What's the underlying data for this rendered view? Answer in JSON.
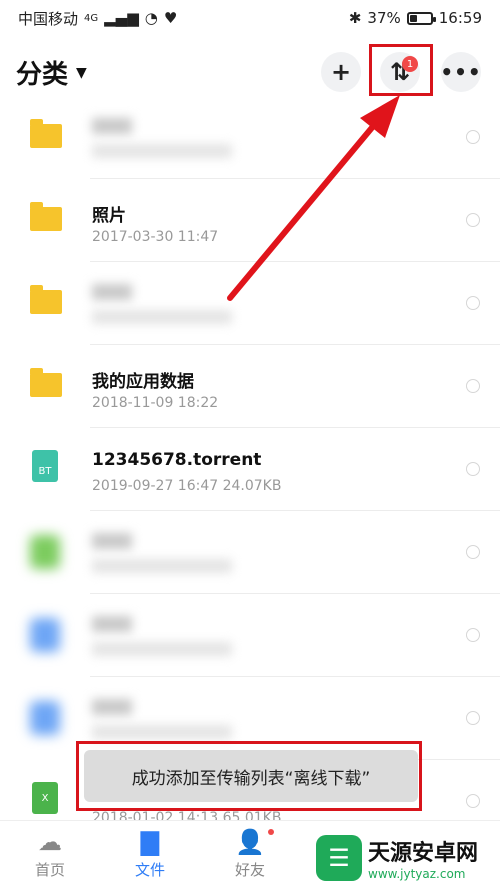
{
  "status_bar": {
    "carrier": "中国移动",
    "network": "4G",
    "bluetooth": "✱",
    "battery_percent": "37%",
    "time": "16:59"
  },
  "header": {
    "title": "分类",
    "add_icon": "+",
    "transfer_icon": "⇅",
    "badge": "1",
    "more_icon": "•••"
  },
  "files": [
    {
      "type": "folder",
      "name": "",
      "meta": "",
      "blurred": true
    },
    {
      "type": "folder",
      "name": "照片",
      "meta": "2017-03-30  11:47",
      "blurred": false
    },
    {
      "type": "folder",
      "name": "",
      "meta": "",
      "blurred": true
    },
    {
      "type": "folder",
      "name": "我的应用数据",
      "meta": "2018-11-09  18:22",
      "blurred": false
    },
    {
      "type": "bt",
      "icon_label": "BT",
      "name": "12345678.torrent",
      "meta": "2019-09-27  16:47   24.07KB",
      "blurred": false
    },
    {
      "type": "green",
      "name": "",
      "meta": "",
      "blurred": true
    },
    {
      "type": "blue",
      "name": "",
      "meta": "",
      "blurred": true
    },
    {
      "type": "blue",
      "name": "",
      "meta": "",
      "blurred": true
    },
    {
      "type": "xls",
      "icon_label": "X",
      "name": "",
      "meta": "2018-01-02  14:13  65.01KB",
      "blurred": false
    }
  ],
  "toast": {
    "text": "成功添加至传输列表“离线下载”"
  },
  "tabs": [
    {
      "label": "首页",
      "icon": "☁",
      "active": false
    },
    {
      "label": "文件",
      "icon": "▇",
      "active": true
    },
    {
      "label": "好友",
      "icon": "👤",
      "active": false
    }
  ],
  "colors": {
    "accent": "#2f7df6",
    "annotation": "#d8141b",
    "folder": "#f6c42c",
    "bt": "#3ec2a8"
  },
  "watermark": {
    "logo": "☰",
    "title": "天源安卓网",
    "url": "www.jytyaz.com"
  }
}
